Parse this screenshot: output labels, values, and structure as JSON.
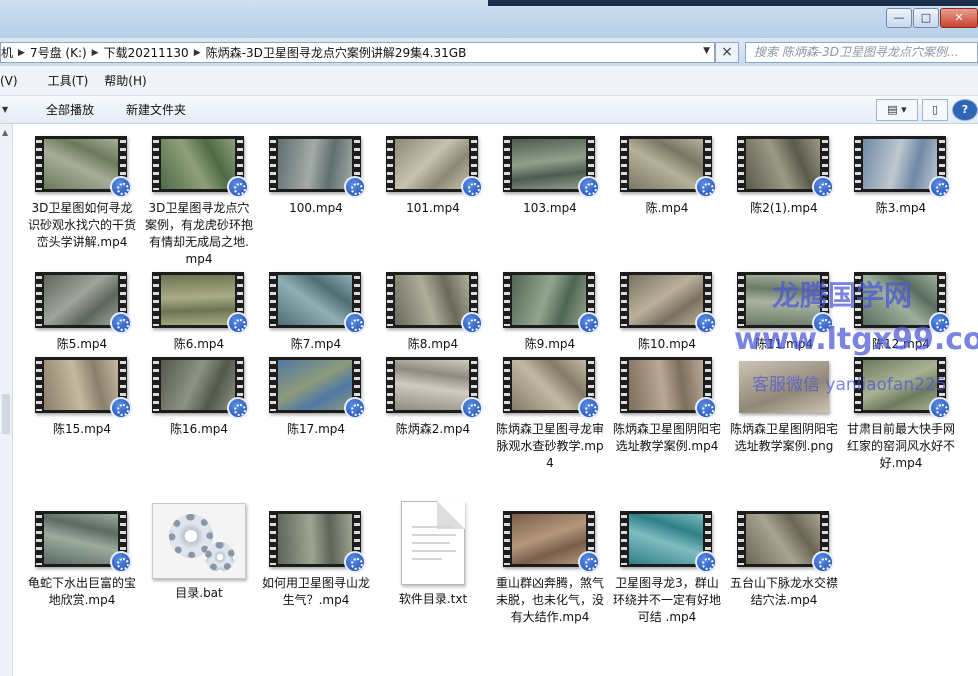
{
  "window": {
    "controls": {
      "minimize": "—",
      "maximize": "□",
      "close": "✕"
    }
  },
  "address": {
    "crumbs": [
      "机",
      "7号盘 (K:)",
      "下载20211130",
      "陈炳森-3D卫星图寻龙点穴案例讲解29集4.31GB"
    ],
    "search_placeholder": "搜索 陈炳森-3D卫星图寻龙点穴案例..."
  },
  "menu": {
    "items": [
      "(V)",
      "工具(T)",
      "帮助(H)"
    ]
  },
  "toolbar": {
    "play_all": "全部播放",
    "new_folder": "新建文件夹"
  },
  "files": [
    {
      "name": "3D卫星图如何寻龙识砂观水找穴的干货峦头学讲解.mp4",
      "type": "video",
      "palette": [
        "#6b7a5a",
        "#a8ad9a"
      ]
    },
    {
      "name": "3D卫星图寻龙点穴案例，有龙虎砂环抱有情却无成局之地.mp4",
      "type": "video",
      "palette": [
        "#4e6a45",
        "#8ea07a"
      ]
    },
    {
      "name": "100.mp4",
      "type": "video",
      "palette": [
        "#5f6f70",
        "#a3aba6"
      ]
    },
    {
      "name": "101.mp4",
      "type": "video",
      "palette": [
        "#8c8777",
        "#c8c2b0"
      ]
    },
    {
      "name": "103.mp4",
      "type": "video",
      "palette": [
        "#4d5c4f",
        "#92a08c"
      ]
    },
    {
      "name": "陈.mp4",
      "type": "video",
      "palette": [
        "#7a7663",
        "#b7b19a"
      ]
    },
    {
      "name": "陈2(1).mp4",
      "type": "video",
      "palette": [
        "#5a5a4c",
        "#9c9a86"
      ]
    },
    {
      "name": "陈3.mp4",
      "type": "video",
      "palette": [
        "#6f89a6",
        "#bfc8cf"
      ]
    },
    {
      "name": "陈5.mp4",
      "type": "video",
      "palette": [
        "#5d655c",
        "#a0a59a"
      ]
    },
    {
      "name": "陈6.mp4",
      "type": "video",
      "palette": [
        "#6d7352",
        "#a9ad85"
      ]
    },
    {
      "name": "陈7.mp4",
      "type": "video",
      "palette": [
        "#4f6d74",
        "#8fb0b4"
      ]
    },
    {
      "name": "陈8.mp4",
      "type": "video",
      "palette": [
        "#6a6a5c",
        "#aeae9c"
      ]
    },
    {
      "name": "陈9.mp4",
      "type": "video",
      "palette": [
        "#506652",
        "#93a58f"
      ]
    },
    {
      "name": "陈10.mp4",
      "type": "video",
      "palette": [
        "#7b7160",
        "#bab09c"
      ]
    },
    {
      "name": "陈11.mp4",
      "type": "video",
      "palette": [
        "#6c7a68",
        "#a9b4a2"
      ]
    },
    {
      "name": "陈12.mp4",
      "type": "video",
      "palette": [
        "#5a6c5d",
        "#9db09d"
      ]
    },
    {
      "name": "陈15.mp4",
      "type": "video",
      "palette": [
        "#8a7f6a",
        "#c4b9a1"
      ]
    },
    {
      "name": "陈16.mp4",
      "type": "video",
      "palette": [
        "#54584c",
        "#8f9385"
      ]
    },
    {
      "name": "陈17.mp4",
      "type": "video",
      "palette": [
        "#4f78a4",
        "#8e9b7a"
      ]
    },
    {
      "name": "陈炳森2.mp4",
      "type": "video",
      "palette": [
        "#8f8a80",
        "#d0cac0"
      ]
    },
    {
      "name": "陈炳森卫星图寻龙审脉观水查砂教学.mp4",
      "type": "video",
      "palette": [
        "#847c69",
        "#c2b9a3"
      ]
    },
    {
      "name": "陈炳森卫星图阴阳宅选址教学案例.mp4",
      "type": "video",
      "palette": [
        "#7d6e5d",
        "#b9a995"
      ]
    },
    {
      "name": "陈炳森卫星图阴阳宅选址教学案例.png",
      "type": "image",
      "palette": [
        "#8f8778",
        "#cdc4b3"
      ]
    },
    {
      "name": "甘肃目前最大快手网红家的窑洞风水好不好.mp4",
      "type": "video",
      "palette": [
        "#6e7a60",
        "#a9b293"
      ]
    },
    {
      "name": "龟蛇下水出巨富的宝地欣赏.mp4",
      "type": "video",
      "palette": [
        "#5b6a62",
        "#9cab9f"
      ]
    },
    {
      "name": "目录.bat",
      "type": "bat",
      "palette": [
        "#8a97a6",
        "#dfe5ec"
      ]
    },
    {
      "name": "如何用卫星图寻山龙生气？.mp4",
      "type": "video",
      "palette": [
        "#5e6456",
        "#9fa593"
      ]
    },
    {
      "name": "软件目录.txt",
      "type": "txt",
      "palette": [
        "#ffffff",
        "#d6d6d6"
      ]
    },
    {
      "name": "重山群凶奔腾，煞气未脱，也未化气，没有大结作.mp4",
      "type": "video",
      "palette": [
        "#7a5e4a",
        "#b5977c"
      ]
    },
    {
      "name": "卫星图寻龙3，群山环绕并不一定有好地可结 .mp4",
      "type": "video",
      "palette": [
        "#2f7f86",
        "#7fbcc0"
      ]
    },
    {
      "name": "五台山下脉龙水交襟结穴法.mp4",
      "type": "video",
      "palette": [
        "#6a6656",
        "#aaa592"
      ]
    }
  ],
  "watermark": {
    "line1": "龙腾国学网",
    "line2": "www.ltgx99.com",
    "line3": "客服微信 yanliaofan225",
    "color": "#4b56d6"
  }
}
